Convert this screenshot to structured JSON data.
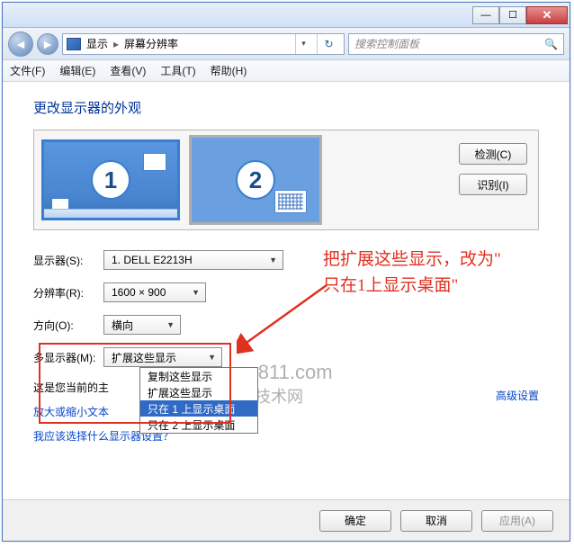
{
  "window": {
    "min": "—",
    "max": "☐",
    "close": "✕"
  },
  "nav": {
    "back": "◄",
    "fwd": "►",
    "crumb1": "显示",
    "sep": "▸",
    "crumb2": "屏幕分辨率",
    "dropdown": "▾",
    "refresh": "↻",
    "search_placeholder": "搜索控制面板",
    "search_icon": "🔍"
  },
  "menu": {
    "file": "文件(F)",
    "edit": "编辑(E)",
    "view": "查看(V)",
    "tools": "工具(T)",
    "help": "帮助(H)"
  },
  "heading": "更改显示器的外观",
  "monitor_nums": {
    "one": "1",
    "two": "2"
  },
  "side_buttons": {
    "detect": "检测(C)",
    "identify": "识别(I)"
  },
  "labels": {
    "monitor": "显示器(S):",
    "resolution": "分辨率(R):",
    "orientation": "方向(O):",
    "multi": "多显示器(M):"
  },
  "selects": {
    "monitor": "1. DELL E2213H",
    "resolution": "1600 × 900",
    "orientation": "横向",
    "multi": "扩展这些显示",
    "arrow": "▼"
  },
  "dropdown": {
    "opt1": "复制这些显示",
    "opt2": "扩展这些显示",
    "opt3": "只在 1 上显示桌面",
    "opt4": "只在 2 上显示桌面"
  },
  "context": {
    "prefix": "这是您当前的主",
    "adv": "高级设置",
    "resize_prefix": "放大或缩小文本",
    "help_link": "我应该选择什么显示器设置？"
  },
  "annotation": {
    "line1": "把扩展这些显示，改为\"",
    "line2": "只在1上显示桌面\""
  },
  "watermark": {
    "l1": "www.pc811.com",
    "l2": "电脑维修技术网"
  },
  "footer": {
    "ok": "确定",
    "cancel": "取消",
    "apply": "应用(A)"
  }
}
